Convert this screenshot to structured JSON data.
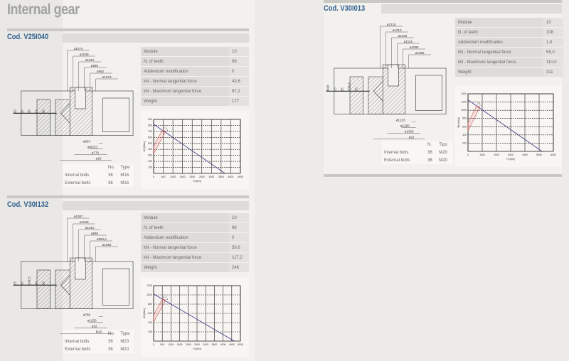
{
  "page_title": "Internal gear",
  "spec_labels": [
    "Module",
    "N. of teeth",
    "Addendum modification",
    "kN - Normal tangential force",
    "kN - Maximum tangential force",
    "Weight"
  ],
  "colors": {
    "code": "#2f5f8f",
    "curve": "#4a3f8a",
    "zone": "#d9534f",
    "title": "#a3a3a3"
  },
  "sections": [
    {
      "code": "Cod. V25I040",
      "specs": [
        "10",
        "98",
        "0",
        "43,6",
        "87,2",
        "177"
      ],
      "bolts": {
        "headers": [
          "No.",
          "Type"
        ],
        "rows": [
          [
            "Internal bolts",
            "36",
            "M16"
          ],
          [
            "External bolts",
            "36",
            "M16"
          ]
        ]
      },
      "dims": [
        "ø1074",
        "ø1040",
        "ø1010",
        "ø980",
        "ø952",
        "ø1073",
        "ø934",
        "ø903,5",
        "ø770",
        "ø18",
        "10",
        "80",
        "28",
        "71",
        "50"
      ],
      "chart": {
        "type": "line",
        "y_ticks": [
          "100",
          "200",
          "300",
          "400",
          "500",
          "600",
          "700",
          "800",
          "900"
        ],
        "x_ticks": [
          "0",
          "500",
          "1000",
          "1500",
          "2000",
          "2500",
          "3000",
          "3500",
          "4000",
          "4500"
        ],
        "xlim": [
          0,
          4500
        ],
        "ylim": [
          0,
          900
        ],
        "xlabel": "Fa [kN]",
        "ylabel": "Mt [kNm]",
        "line": [
          [
            0,
            820
          ],
          [
            3700,
            0
          ]
        ],
        "marker_labels": [
          "2,1",
          "1"
        ]
      }
    },
    {
      "code": "Cod. V30I013",
      "specs": [
        "10",
        "108",
        "1,5",
        "55,0",
        "110,0",
        "311"
      ],
      "bolts": {
        "headers": [
          "N.",
          "Tipo"
        ],
        "rows": [
          [
            "Internal bolts",
            "36",
            "M20"
          ],
          [
            "External bolts",
            "36",
            "M20"
          ]
        ]
      },
      "dims": [
        "ø1218",
        "ø1210",
        "ø1150",
        "ø1115",
        "ø1080",
        "ø1066",
        "ø1223",
        "ø1290",
        "ø1363",
        "ø22",
        "M20",
        "23",
        "85",
        "106±1",
        "75"
      ],
      "chart": {
        "type": "line",
        "y_ticks": [
          "200",
          "400",
          "600",
          "800",
          "1000",
          "1200",
          "1400"
        ],
        "x_ticks": [
          "0",
          "1000",
          "2000",
          "3000",
          "4000",
          "5000",
          "6000"
        ],
        "xlim": [
          0,
          6000
        ],
        "ylim": [
          0,
          1400
        ],
        "xlabel": "Fa [kN]",
        "ylabel": "Mt [kNm]",
        "line": [
          [
            0,
            1250
          ],
          [
            5200,
            0
          ]
        ],
        "marker_labels": [
          "2,1",
          "1"
        ]
      }
    },
    {
      "code": "Cod. V30I132",
      "specs": [
        "10",
        "98",
        "0",
        "58,6",
        "117,2",
        "248"
      ],
      "bolts": {
        "headers": [
          "No.",
          "Type"
        ],
        "rows": [
          [
            "Internal bolts",
            "36",
            "M20"
          ],
          [
            "External bolts",
            "36",
            "M20"
          ]
        ]
      },
      "dims": [
        "ø1087",
        "ø1040",
        "ø1010",
        "ø980",
        "ø953,5",
        "ø1092",
        "ø786",
        "ø1200",
        "ø22",
        "M20",
        "23",
        "85",
        "106±1",
        "90",
        "98"
      ],
      "chart": {
        "type": "line",
        "y_ticks": [
          "200",
          "400",
          "600",
          "800",
          "1000",
          "1200"
        ],
        "x_ticks": [
          "0",
          "500",
          "1000",
          "1500",
          "2000",
          "2500",
          "3000",
          "3500",
          "4000",
          "4500",
          "5000"
        ],
        "xlim": [
          0,
          5000
        ],
        "ylim": [
          0,
          1200
        ],
        "xlabel": "Fa [kN]",
        "ylabel": "Mt [kNm]",
        "line": [
          [
            0,
            1020
          ],
          [
            4650,
            0
          ]
        ],
        "marker_labels": [
          "2,1",
          "1"
        ]
      }
    }
  ]
}
